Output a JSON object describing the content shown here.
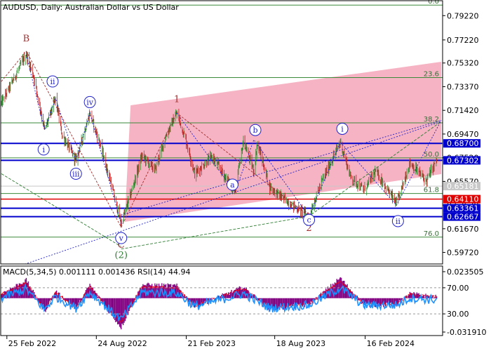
{
  "header": {
    "main_label": "AUDUSD, Daily:  Australian Dollar vs US Dollar",
    "macd_label": "MACD(5,34,5) 0.001111 0.001436 RSI(14) 44.94"
  },
  "colors": {
    "background": "#ffffff",
    "frame": "#000000",
    "bull_candle": "#2e8b2e",
    "bear_candle": "#c02020",
    "fib_line": "#3a8a3a",
    "fib_text": "#3a6e3a",
    "blue_level": "#0000cd",
    "red_level": "#e00000",
    "grey_level": "#c8c8c8",
    "channel_fill": "#f4a6b8",
    "wave_red": "#a03030",
    "wave_green": "#2e7d32",
    "wave_blue": "#2222cc",
    "macd_hist": "#800080",
    "signal": "#ff0000",
    "rsi": "#1e90ff"
  },
  "chart_data": [
    {
      "type": "candlestick",
      "title": "AUDUSD, Daily:  Australian Dollar vs US Dollar",
      "x_axis_labels": [
        "25 Feb 2022",
        "24 Aug 2022",
        "21 Feb 2023",
        "18 Aug 2023",
        "16 Feb 2024"
      ],
      "x_range": [
        "2022-02-14",
        "2024-07-18"
      ],
      "y_range": [
        0.5877,
        0.8045
      ],
      "y_tick_labels": [
        "0.79220",
        "0.77220",
        "0.75320",
        "0.73370",
        "0.71420",
        "0.69470",
        "0.67520",
        "0.65570",
        "0.63620",
        "0.61670",
        "0.59720"
      ],
      "y_ticks": [
        0.7922,
        0.7722,
        0.7532,
        0.7337,
        0.7142,
        0.6947,
        0.6752,
        0.6557,
        0.6362,
        0.6167,
        0.5972
      ],
      "fibonacci": [
        {
          "label": "0.0",
          "value": 0.8009
        },
        {
          "label": "23.6",
          "value": 0.7412
        },
        {
          "label": "38.2",
          "value": 0.7039
        },
        {
          "label": "50.0",
          "value": 0.6751
        },
        {
          "label": "61.8",
          "value": 0.6457
        },
        {
          "label": "76.0",
          "value": 0.6098
        }
      ],
      "price_levels": [
        {
          "value": 0.687,
          "label": "0.68700",
          "color": "#0000cd"
        },
        {
          "value": 0.67302,
          "label": "0.67302",
          "color": "#0000cd"
        },
        {
          "value": 0.65181,
          "label": "0.65181",
          "color": "#c8c8c8"
        },
        {
          "value": 0.6411,
          "label": "0.64110",
          "color": "#e00000"
        },
        {
          "value": 0.63361,
          "label": "0.63361",
          "color": "#0000cd"
        },
        {
          "value": 0.62667,
          "label": "0.62667",
          "color": "#0000cd"
        }
      ],
      "wave_labels": [
        {
          "text": "B",
          "style": "red"
        },
        {
          "text": "1",
          "style": "red"
        },
        {
          "text": "2",
          "style": "red"
        },
        {
          "text": "C",
          "style": "red"
        },
        {
          "text": "(2)",
          "style": "green"
        },
        {
          "text": "i",
          "style": "circle"
        },
        {
          "text": "ii",
          "style": "circle"
        },
        {
          "text": "iii",
          "style": "circle"
        },
        {
          "text": "iv",
          "style": "circle"
        },
        {
          "text": "v",
          "style": "circle"
        },
        {
          "text": "a",
          "style": "circle"
        },
        {
          "text": "b",
          "style": "circle"
        },
        {
          "text": "c",
          "style": "circle"
        },
        {
          "text": "i",
          "style": "circle"
        },
        {
          "text": "ii",
          "style": "circle"
        }
      ],
      "price_path": [
        [
          "2022-02-14",
          0.72
        ],
        [
          "2022-03-07",
          0.737
        ],
        [
          "2022-04-05",
          0.7605
        ],
        [
          "2022-04-20",
          0.742
        ],
        [
          "2022-05-12",
          0.698
        ],
        [
          "2022-06-03",
          0.724
        ],
        [
          "2022-06-16",
          0.694
        ],
        [
          "2022-07-14",
          0.673
        ],
        [
          "2022-08-11",
          0.712
        ],
        [
          "2022-09-01",
          0.686
        ],
        [
          "2022-09-22",
          0.655
        ],
        [
          "2022-10-13",
          0.621
        ],
        [
          "2022-11-01",
          0.645
        ],
        [
          "2022-11-24",
          0.677
        ],
        [
          "2022-12-20",
          0.665
        ],
        [
          "2023-01-12",
          0.694
        ],
        [
          "2023-02-02",
          0.712
        ],
        [
          "2023-02-20",
          0.69
        ],
        [
          "2023-03-10",
          0.662
        ],
        [
          "2023-04-14",
          0.676
        ],
        [
          "2023-05-30",
          0.647
        ],
        [
          "2023-06-16",
          0.689
        ],
        [
          "2023-07-07",
          0.664
        ],
        [
          "2023-07-14",
          0.687
        ],
        [
          "2023-08-08",
          0.651
        ],
        [
          "2023-09-12",
          0.639
        ],
        [
          "2023-10-26",
          0.627
        ],
        [
          "2023-11-20",
          0.655
        ],
        [
          "2023-12-28",
          0.688
        ],
        [
          "2024-01-17",
          0.66
        ],
        [
          "2024-02-13",
          0.648
        ],
        [
          "2024-03-08",
          0.664
        ],
        [
          "2024-04-19",
          0.637
        ],
        [
          "2024-05-16",
          0.671
        ],
        [
          "2024-06-18",
          0.656
        ],
        [
          "2024-07-10",
          0.674
        ]
      ]
    },
    {
      "type": "line",
      "title": "MACD(5,34,5) 0.001111 0.001436 RSI(14) 44.94",
      "y_tick_labels": [
        "0.023505",
        "70.00",
        "30.00",
        "-0.031910"
      ],
      "y_ticks": [
        0.023505,
        0.0,
        -0.03191
      ],
      "rsi_levels": [
        70,
        30
      ],
      "series": [
        {
          "name": "MACD",
          "kind": "histogram",
          "value": 0.001111
        },
        {
          "name": "signal",
          "kind": "line",
          "value": 0.001436
        },
        {
          "name": "RSI(14)",
          "kind": "line",
          "value": 44.94
        }
      ],
      "macd_path": [
        [
          "2022-02-14",
          0.004
        ],
        [
          "2022-04-05",
          0.016
        ],
        [
          "2022-05-12",
          -0.012
        ],
        [
          "2022-06-03",
          0.006
        ],
        [
          "2022-07-14",
          -0.01
        ],
        [
          "2022-08-11",
          0.012
        ],
        [
          "2022-09-22",
          -0.014
        ],
        [
          "2022-10-13",
          -0.026
        ],
        [
          "2022-11-24",
          0.012
        ],
        [
          "2023-02-02",
          0.011
        ],
        [
          "2023-03-10",
          -0.008
        ],
        [
          "2023-06-16",
          0.01
        ],
        [
          "2023-08-08",
          -0.01
        ],
        [
          "2023-10-26",
          -0.006
        ],
        [
          "2023-12-28",
          0.018
        ],
        [
          "2024-02-13",
          -0.006
        ],
        [
          "2024-04-19",
          -0.006
        ],
        [
          "2024-05-16",
          0.004
        ],
        [
          "2024-07-10",
          0.001
        ]
      ]
    }
  ]
}
